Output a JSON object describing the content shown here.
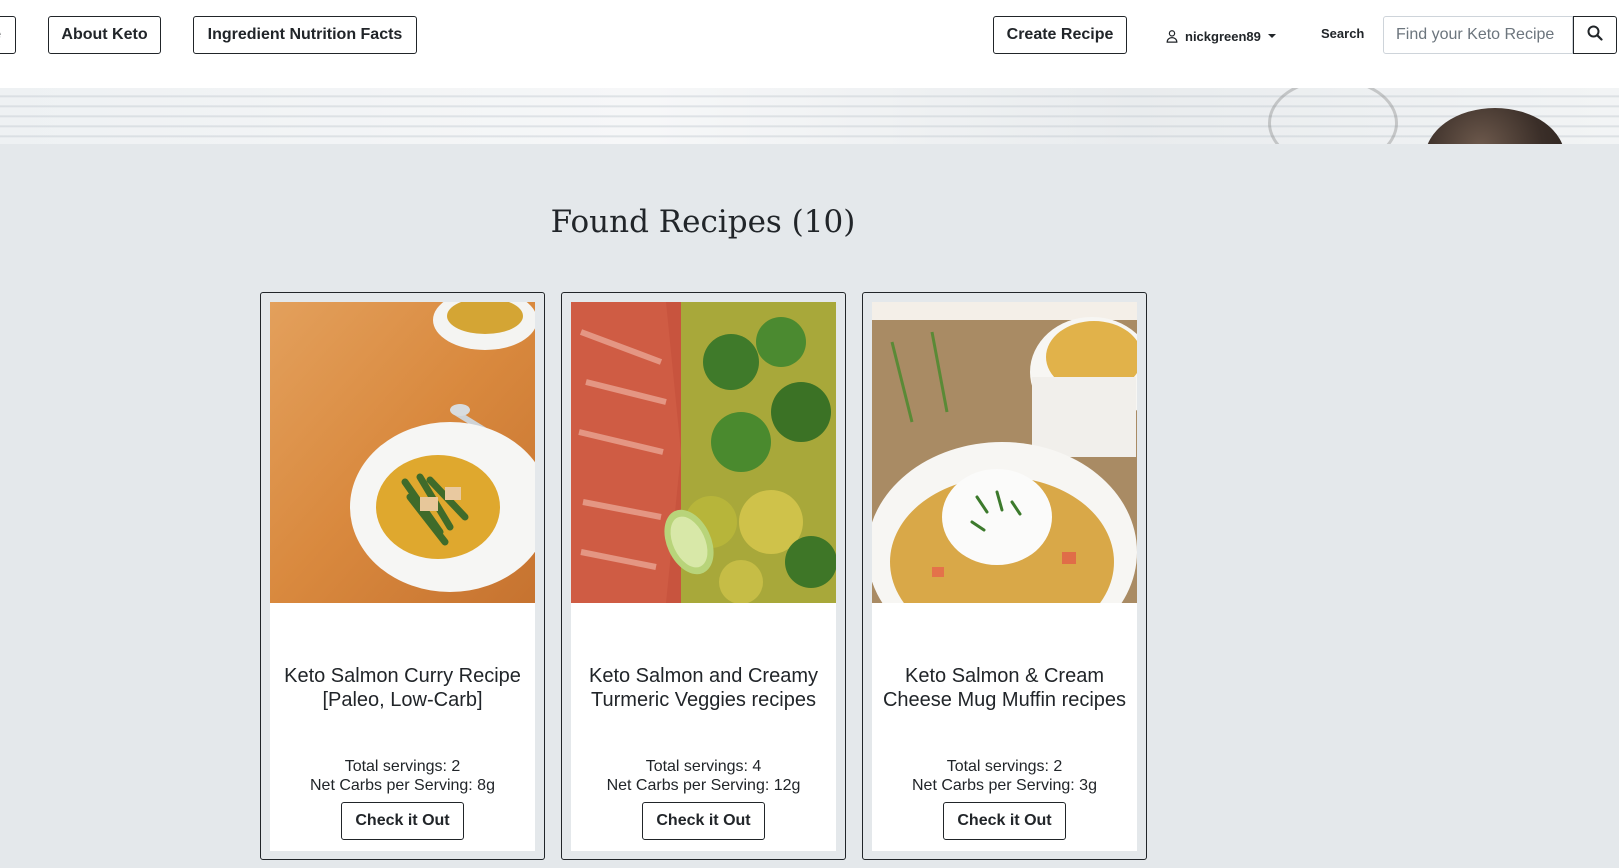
{
  "navbar": {
    "partial_button_label": "e",
    "about_label": "About Keto",
    "ingredient_label": "Ingredient Nutrition Facts",
    "create_label": "Create Recipe",
    "username": "nickgreen89",
    "search_label": "Search",
    "search_placeholder": "Find your Keto Recipe",
    "icons": {
      "user": "user-icon",
      "caret": "caret-down-icon",
      "search": "magnifier-icon"
    }
  },
  "main": {
    "heading": "Found Recipes (10)"
  },
  "cards": [
    {
      "title": "Keto Salmon Curry Recipe [Paleo, Low-Carb]",
      "servings": "Total servings: 2",
      "carbs": "Net Carbs per Serving: 8g",
      "button": "Check it Out"
    },
    {
      "title": "Keto Salmon and Creamy Turmeric Veggies recipes",
      "servings": "Total servings: 4",
      "carbs": "Net Carbs per Serving: 12g",
      "button": "Check it Out"
    },
    {
      "title": "Keto Salmon & Cream Cheese Mug Muffin recipes",
      "servings": "Total servings: 2",
      "carbs": "Net Carbs per Serving: 3g",
      "button": "Check it Out"
    }
  ],
  "colors": {
    "page_bg": "#e4e8eb",
    "text": "#212529",
    "navbar_bg": "#ffffff"
  }
}
